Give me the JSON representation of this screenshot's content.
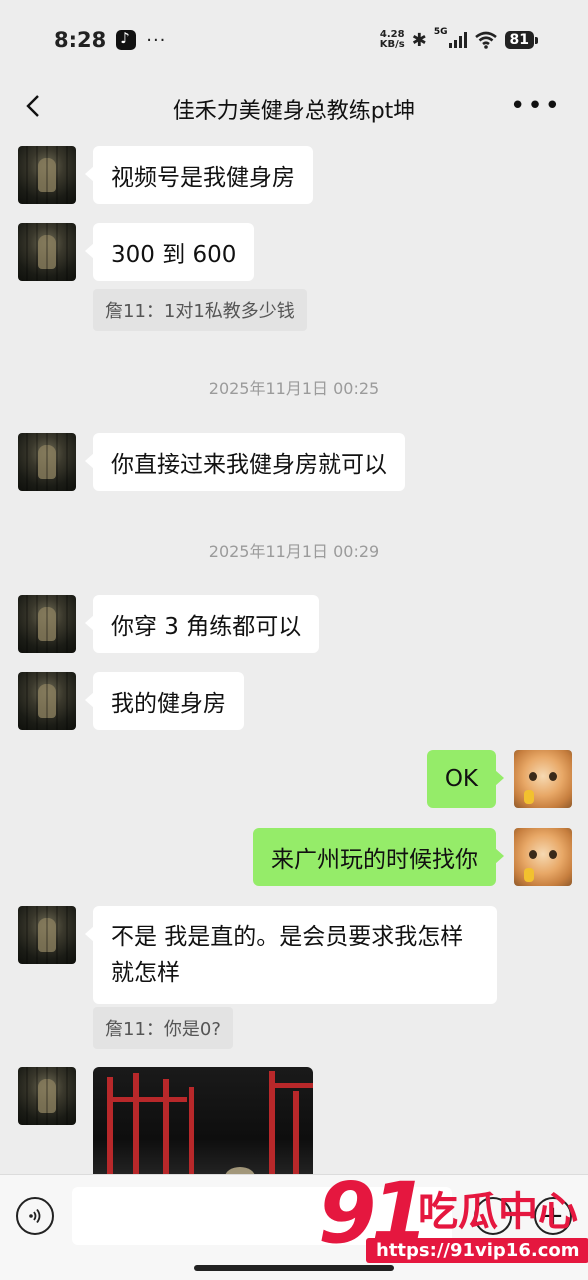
{
  "status_bar": {
    "time": "8:28",
    "more": "···",
    "net_speed_value": "4.28",
    "net_speed_unit": "KB/s",
    "network": "5G",
    "battery": "81"
  },
  "header": {
    "title": "佳禾力美健身总教练pt坤"
  },
  "messages": [
    {
      "side": "left",
      "text": "视频号是我健身房"
    },
    {
      "side": "left",
      "text": "300 到 600"
    },
    {
      "quote": "詹11：1对1私教多少钱"
    },
    {
      "timestamp": "2025年11月1日 00:25"
    },
    {
      "side": "left",
      "text": "你直接过来我健身房就可以"
    },
    {
      "timestamp": "2025年11月1日 00:29"
    },
    {
      "side": "left",
      "text": "你穿 3 角练都可以"
    },
    {
      "side": "left",
      "text": "我的健身房"
    },
    {
      "side": "right",
      "text": "OK"
    },
    {
      "side": "right",
      "text": "来广州玩的时候找你"
    },
    {
      "side": "left",
      "text": "不是 我是直的。是会员要求我怎样就怎样"
    },
    {
      "quote": "詹11：你是0?"
    },
    {
      "side": "left",
      "type": "image"
    }
  ],
  "watermark": {
    "number": "91",
    "name": "吃瓜中心",
    "url": "https://91vip16.com"
  },
  "icons": {
    "back": "chevron-left-icon",
    "more": "more-icon",
    "voice": "voice-icon",
    "emoji": "emoji-icon",
    "plus": "plus-icon"
  },
  "colors": {
    "background": "#ededed",
    "sent_bubble": "#95ec69",
    "received_bubble": "#ffffff",
    "watermark": "#e5173f"
  }
}
